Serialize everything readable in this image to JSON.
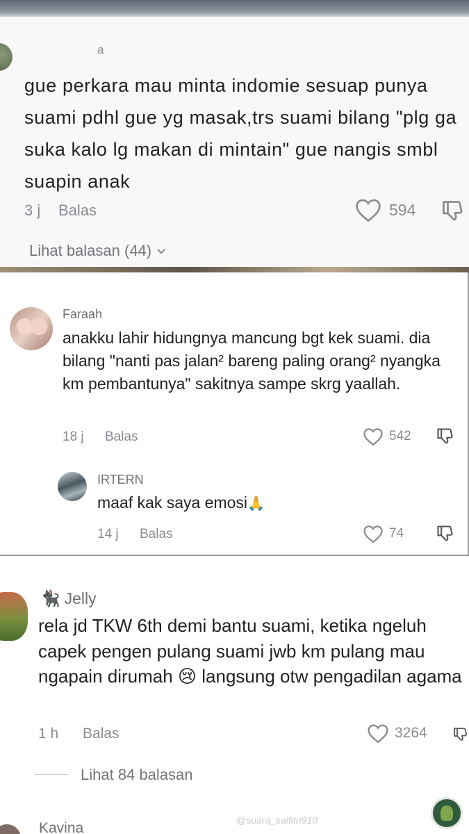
{
  "comments": [
    {
      "username": "a",
      "text": "gue perkara mau minta indomie sesuap punya suami pdhl gue yg masak,trs suami bilang \"plg ga suka kalo lg makan di mintain\" gue nangis smbl suapin anak",
      "time": "3 j",
      "reply_label": "Balas",
      "likes": "594",
      "view_replies": "Lihat balasan (44)"
    },
    {
      "username": "Faraah",
      "text": "anakku lahir hidungnya mancung bgt kek suami. dia bilang \"nanti pas jalan² bareng paling orang² nyangka km pembantunya\" sakitnya sampe skrg yaallah.",
      "time": "18 j",
      "reply_label": "Balas",
      "likes": "542",
      "reply": {
        "username": "IRTERN",
        "text": "maaf kak saya emosi",
        "emoji": "🙏",
        "time": "14 j",
        "reply_label": "Balas",
        "likes": "74"
      }
    },
    {
      "username": "Jelly",
      "username_icon": "🐈‍⬛",
      "text": "rela jd TKW 6th demi bantu suami, ketika ngeluh capek pengen pulang suami jwb km pulang mau ngapain dirumah 😢 langsung otw pengadilan agama",
      "time": "1 h",
      "reply_label": "Balas",
      "likes": "3264",
      "view_replies": "Lihat 84 balasan"
    },
    {
      "username": "Kavina"
    }
  ],
  "watermark": "@suara_saifitri910",
  "icons": {
    "like": "heart-outline-icon",
    "dislike": "thumbs-down-icon",
    "chevron": "chevron-down-icon"
  },
  "colors": {
    "text": "#222222",
    "meta": "#8a8b91"
  }
}
